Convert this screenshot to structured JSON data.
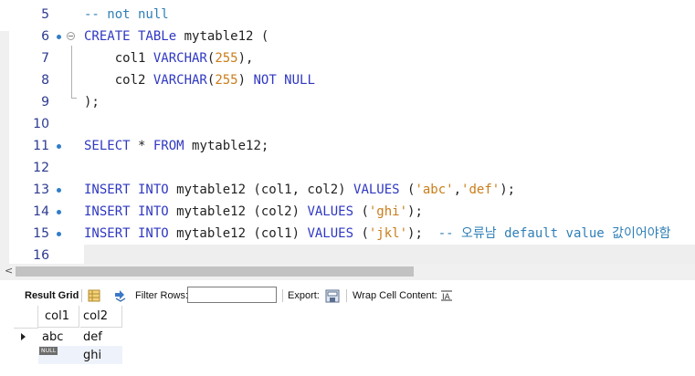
{
  "editor": {
    "lines": [
      {
        "n": "5",
        "tokens": [
          [
            "cm",
            "-- not null"
          ]
        ]
      },
      {
        "n": "6",
        "tokens": [
          [
            "kw",
            "CREATE TABLe"
          ],
          [
            "tx",
            " mytable12 ("
          ]
        ]
      },
      {
        "n": "7",
        "tokens": [
          [
            "tx",
            "    col1 "
          ],
          [
            "kw",
            "VARCHAR"
          ],
          [
            "tx",
            "("
          ],
          [
            "num",
            "255"
          ],
          [
            "tx",
            "),"
          ]
        ]
      },
      {
        "n": "8",
        "tokens": [
          [
            "tx",
            "    col2 "
          ],
          [
            "kw",
            "VARCHAR"
          ],
          [
            "tx",
            "("
          ],
          [
            "num",
            "255"
          ],
          [
            "tx",
            ") "
          ],
          [
            "kw",
            "NOT NULL"
          ]
        ]
      },
      {
        "n": "9",
        "tokens": [
          [
            "tx",
            ");"
          ]
        ]
      },
      {
        "n": "10",
        "tokens": []
      },
      {
        "n": "11",
        "tokens": [
          [
            "kw",
            "SELECT"
          ],
          [
            "tx",
            " * "
          ],
          [
            "kw",
            "FROM"
          ],
          [
            "tx",
            " mytable12;"
          ]
        ]
      },
      {
        "n": "12",
        "tokens": []
      },
      {
        "n": "13",
        "tokens": [
          [
            "kw",
            "INSERT INTO"
          ],
          [
            "tx",
            " mytable12 (col1, col2) "
          ],
          [
            "kw",
            "VALUES"
          ],
          [
            "tx",
            " ("
          ],
          [
            "str",
            "'abc'"
          ],
          [
            "tx",
            ","
          ],
          [
            "str",
            "'def'"
          ],
          [
            "tx",
            ");"
          ]
        ]
      },
      {
        "n": "14",
        "tokens": [
          [
            "kw",
            "INSERT INTO"
          ],
          [
            "tx",
            " mytable12 (col2) "
          ],
          [
            "kw",
            "VALUES"
          ],
          [
            "tx",
            " ("
          ],
          [
            "str",
            "'ghi'"
          ],
          [
            "tx",
            ");"
          ]
        ]
      },
      {
        "n": "15",
        "tokens": [
          [
            "kw",
            "INSERT INTO"
          ],
          [
            "tx",
            " mytable12 (col1) "
          ],
          [
            "kw",
            "VALUES"
          ],
          [
            "tx",
            " ("
          ],
          [
            "str",
            "'jkl'"
          ],
          [
            "tx",
            ");  "
          ],
          [
            "cm",
            "-- 오류남 default value 값이어야함"
          ]
        ]
      },
      {
        "n": "16",
        "tokens": []
      }
    ]
  },
  "toolbar": {
    "result_grid": "Result Grid",
    "filter_rows": "Filter Rows:",
    "filter_value": "",
    "export": "Export:",
    "wrap_cell": "Wrap Cell Content:"
  },
  "grid": {
    "columns": [
      "col1",
      "col2"
    ],
    "rows": [
      [
        "abc",
        "def"
      ],
      [
        "NULL",
        "ghi"
      ]
    ]
  },
  "icons": {
    "scroll_left": "chevron-left-icon",
    "grid_form": "form-view-icon",
    "refresh": "refresh-icon",
    "export": "export-icon",
    "wrap": "wrap-text-icon"
  }
}
